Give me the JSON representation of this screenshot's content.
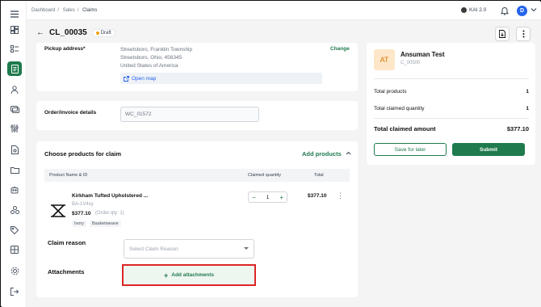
{
  "breadcrumb": [
    "Dashboard",
    "Sales",
    "Claims"
  ],
  "header": {
    "kai_label": "KAI 2.0",
    "avatar_initial": "D"
  },
  "page": {
    "title": "CL_00035",
    "status": "Draft"
  },
  "pickup": {
    "label": "Pickup address*",
    "lines": [
      "Streetsboro, Franklin Township",
      "Streetsboro, Ohio, 456345",
      "United States of America"
    ],
    "change_label": "Change",
    "open_map_label": "Open map"
  },
  "order": {
    "label": "Order/invoice details",
    "value": "WC_01572"
  },
  "products": {
    "section_title": "Choose products for claim",
    "add_label": "Add products",
    "columns": [
      "Product Name & ID",
      "Claimed quantity",
      "Total"
    ],
    "items": [
      {
        "name": "Kirkham Tufted Upholstered ...",
        "sku": "BA-1V4sy",
        "price": "$377.10",
        "order_qty": "(Order qty: 1)",
        "tags": [
          "Ivory",
          "Basketweave"
        ],
        "qty": "1",
        "total": "$377.10"
      }
    ]
  },
  "claim_reason": {
    "label": "Claim reason",
    "placeholder": "Select Claim Reason"
  },
  "attachments": {
    "label": "Attachments",
    "button_label": "Add attachments"
  },
  "customer": {
    "initials": "AT",
    "name": "Ansuman Test",
    "id": "C_00500"
  },
  "summary": {
    "total_products_label": "Total products",
    "total_products": "1",
    "total_claimed_qty_label": "Total claimed quantity",
    "total_claimed_qty": "1",
    "total_claimed_amount_label": "Total claimed amount",
    "total_claimed_amount": "$377.10"
  },
  "actions": {
    "save_label": "Save for later",
    "submit_label": "Submit"
  },
  "colors": {
    "accent": "#1f7a4d",
    "highlight_border": "#dc2626"
  }
}
